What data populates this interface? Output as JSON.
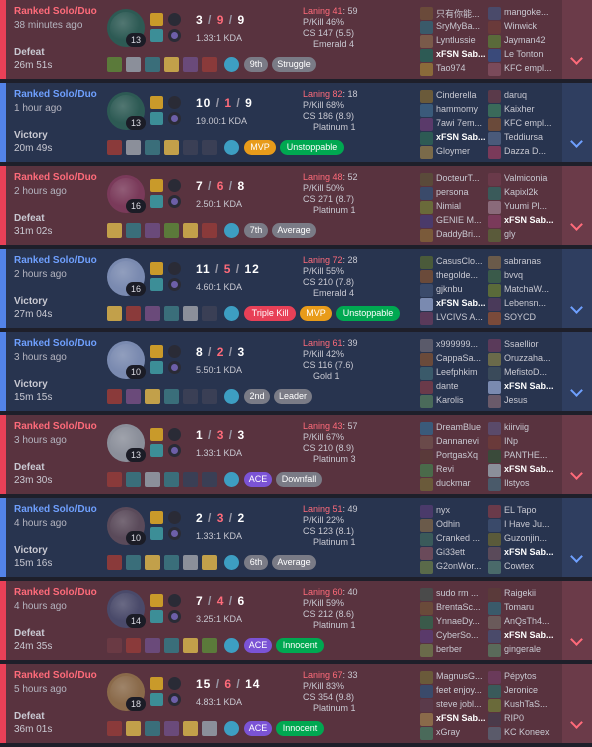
{
  "colors": {
    "defeat_bg": "#59333f",
    "victory_bg": "#28344f",
    "defeat_accent": "#e84057",
    "victory_accent": "#5383e8"
  },
  "games": [
    {
      "result_type": "defeat",
      "mode": "Ranked Solo/Duo",
      "time_ago": "38 minutes ago",
      "result": "Defeat",
      "duration": "26m 51s",
      "champion_color": "#2d5a54",
      "level": "13",
      "kills": "3",
      "deaths": "9",
      "assists": "9",
      "kda": "1.33:1 KDA",
      "laning": "Laning 41",
      "laning_score": ": 59",
      "pkill": "P/Kill 46%",
      "cs": "CS 147 (5.5)",
      "rank": "Emerald 4",
      "items": [
        "#5b7a3a",
        "#8b8f9a",
        "#3a6e7a",
        "#c2a04a",
        "#6a4a7a",
        "#8a3a3a"
      ],
      "badges": [
        {
          "text": "9th",
          "style": "b-place",
          "w": 24
        },
        {
          "text": "Struggle",
          "style": "b-place",
          "w": 44
        }
      ],
      "team_a": [
        {
          "name": "只有你能...",
          "color": "#6a4a3a"
        },
        {
          "name": "SryMyBa...",
          "color": "#3a5a6a"
        },
        {
          "name": "Lyntlussie",
          "color": "#7a5a4a"
        },
        {
          "name": "xFSN Sab...",
          "color": "#2d5a54",
          "me": true
        },
        {
          "name": "Tao974",
          "color": "#8a6a3a"
        }
      ],
      "team_b": [
        {
          "name": "mangoke...",
          "color": "#4a4a6a"
        },
        {
          "name": "Winwick",
          "color": "#6a3a3a"
        },
        {
          "name": "Jayman42",
          "color": "#5a6a3a"
        },
        {
          "name": "Le Tonton",
          "color": "#3a4a7a"
        },
        {
          "name": "KFC empl...",
          "color": "#7a4a5a"
        }
      ]
    },
    {
      "result_type": "victory",
      "mode": "Ranked Solo/Duo",
      "time_ago": "1 hour ago",
      "result": "Victory",
      "duration": "20m 49s",
      "champion_color": "#2d5a54",
      "level": "13",
      "kills": "10",
      "deaths": "1",
      "assists": "9",
      "kda": "19.00:1 KDA",
      "laning": "Laning 82",
      "laning_score": ": 18",
      "pkill": "P/Kill 68%",
      "cs": "CS 186 (8.9)",
      "rank": "Platinum 1",
      "items": [
        "#8a3a3a",
        "#8b8f9a",
        "#3a6e7a",
        "#c2a04a",
        "#3a3f55",
        "#3a3f55"
      ],
      "badges": [
        {
          "text": "MVP",
          "style": "b-gold",
          "w": 32
        },
        {
          "text": "Unstoppable",
          "style": "b-green",
          "w": 64
        }
      ],
      "team_a": [
        {
          "name": "Cinderella",
          "color": "#6a5a3a"
        },
        {
          "name": "hammomy",
          "color": "#3a5a7a"
        },
        {
          "name": "7awi 7em...",
          "color": "#5a3a6a"
        },
        {
          "name": "xFSN Sab...",
          "color": "#2d5a54",
          "me": true
        },
        {
          "name": "Gloymer",
          "color": "#7a6a4a"
        }
      ],
      "team_b": [
        {
          "name": "daruq",
          "color": "#5a3a4a"
        },
        {
          "name": "Kaixher",
          "color": "#3a6a5a"
        },
        {
          "name": "KFC empl...",
          "color": "#6a4a3a"
        },
        {
          "name": "Teddiursa",
          "color": "#4a5a7a"
        },
        {
          "name": "Dazza D...",
          "color": "#7a3a5a"
        }
      ]
    },
    {
      "result_type": "defeat",
      "mode": "Ranked Solo/Duo",
      "time_ago": "2 hours ago",
      "result": "Defeat",
      "duration": "31m 02s",
      "champion_color": "#7a3a5a",
      "level": "16",
      "kills": "7",
      "deaths": "6",
      "assists": "8",
      "kda": "2.50:1 KDA",
      "laning": "Laning 48",
      "laning_score": ": 52",
      "pkill": "P/Kill 50%",
      "cs": "CS 271 (8.7)",
      "rank": "Platinum 1",
      "items": [
        "#c2a04a",
        "#3a6e7a",
        "#6a4a7a",
        "#5b7a3a",
        "#c2a04a",
        "#8a3a3a"
      ],
      "badges": [
        {
          "text": "7th",
          "style": "b-place",
          "w": 24
        },
        {
          "text": "Average",
          "style": "b-place",
          "w": 44
        }
      ],
      "team_a": [
        {
          "name": "DocteurT...",
          "color": "#5a4a3a"
        },
        {
          "name": "persona",
          "color": "#3a4a6a"
        },
        {
          "name": "Nimial",
          "color": "#6a6a3a"
        },
        {
          "name": "GENIE M...",
          "color": "#4a3a6a"
        },
        {
          "name": "DaddyBri...",
          "color": "#7a5a3a"
        }
      ],
      "team_b": [
        {
          "name": "Valmiconia",
          "color": "#6a3a4a"
        },
        {
          "name": "Kapixl2k",
          "color": "#3a5a5a"
        },
        {
          "name": "Yuumi Pl...",
          "color": "#8a6a7a"
        },
        {
          "name": "xFSN Sab...",
          "color": "#7a3a5a",
          "me": true
        },
        {
          "name": "gly",
          "color": "#5a5a3a"
        }
      ]
    },
    {
      "result_type": "victory",
      "mode": "Ranked Solo/Duo",
      "time_ago": "2 hours ago",
      "result": "Victory",
      "duration": "27m 04s",
      "champion_color": "#7a8ab0",
      "level": "16",
      "kills": "11",
      "deaths": "5",
      "assists": "12",
      "kda": "4.60:1 KDA",
      "laning": "Laning 72",
      "laning_score": ": 28",
      "pkill": "P/Kill 55%",
      "cs": "CS 210 (7.8)",
      "rank": "Emerald 4",
      "items": [
        "#c2a04a",
        "#8a3a3a",
        "#6a4a7a",
        "#3a6e7a",
        "#8b8f9a",
        "#3a3f55"
      ],
      "badges": [
        {
          "text": "Triple Kill",
          "style": "b-red",
          "w": 52
        },
        {
          "text": "MVP",
          "style": "b-gold",
          "w": 32
        },
        {
          "text": "Unstoppable",
          "style": "b-green",
          "w": 64
        }
      ],
      "team_a": [
        {
          "name": "CasusClo...",
          "color": "#4a5a3a"
        },
        {
          "name": "thegolde...",
          "color": "#6a4a3a"
        },
        {
          "name": "gjknbu",
          "color": "#3a4a6a"
        },
        {
          "name": "xFSN Sab...",
          "color": "#7a8ab0",
          "me": true
        },
        {
          "name": "LVCIVS A...",
          "color": "#5a3a5a"
        }
      ],
      "team_b": [
        {
          "name": "sabranas",
          "color": "#6a5a4a"
        },
        {
          "name": "bvvq",
          "color": "#3a5a4a"
        },
        {
          "name": "MatchaW...",
          "color": "#5a6a3a"
        },
        {
          "name": "Lebensn...",
          "color": "#4a3a5a"
        },
        {
          "name": "SOYCD",
          "color": "#7a4a3a"
        }
      ]
    },
    {
      "result_type": "victory",
      "mode": "Ranked Solo/Duo",
      "time_ago": "3 hours ago",
      "result": "Victory",
      "duration": "15m 15s",
      "champion_color": "#7a8ab0",
      "level": "10",
      "kills": "8",
      "deaths": "2",
      "assists": "3",
      "kda": "5.50:1 KDA",
      "laning": "Laning 61",
      "laning_score": ": 39",
      "pkill": "P/Kill 42%",
      "cs": "CS 116 (7.6)",
      "rank": "Gold 1",
      "items": [
        "#8a3a3a",
        "#6a4a7a",
        "#c2a04a",
        "#3a6e7a",
        "#3a3f55",
        "#3a3f55"
      ],
      "badges": [
        {
          "text": "2nd",
          "style": "b-place",
          "w": 26
        },
        {
          "text": "Leader",
          "style": "b-place",
          "w": 38
        }
      ],
      "team_a": [
        {
          "name": "x999999...",
          "color": "#5a5a6a"
        },
        {
          "name": "CappaSa...",
          "color": "#6a4a3a"
        },
        {
          "name": "Leefphkim",
          "color": "#3a5a6a"
        },
        {
          "name": "dante",
          "color": "#6a3a4a"
        },
        {
          "name": "Karolis",
          "color": "#4a6a5a"
        }
      ],
      "team_b": [
        {
          "name": "Ssaellior",
          "color": "#5a3a5a"
        },
        {
          "name": "Oruzzaha...",
          "color": "#6a6a4a"
        },
        {
          "name": "MefistoD...",
          "color": "#3a4a5a"
        },
        {
          "name": "xFSN Sab...",
          "color": "#7a8ab0",
          "me": true
        },
        {
          "name": "Jesus",
          "color": "#6a5a6a"
        }
      ]
    },
    {
      "result_type": "defeat",
      "mode": "Ranked Solo/Duo",
      "time_ago": "3 hours ago",
      "result": "Defeat",
      "duration": "23m 30s",
      "champion_color": "#8b8f9a",
      "level": "13",
      "kills": "1",
      "deaths": "3",
      "assists": "3",
      "kda": "1.33:1 KDA",
      "laning": "Laning 43",
      "laning_score": ": 57",
      "pkill": "P/Kill 67%",
      "cs": "CS 210 (8.9)",
      "rank": "Platinum 3",
      "items": [
        "#8a3a3a",
        "#3a6e7a",
        "#8b8f9a",
        "#3a6e7a",
        "#3a3f55",
        "#3a3f55"
      ],
      "badges": [
        {
          "text": "ACE",
          "style": "b-purple",
          "w": 28
        },
        {
          "text": "Downfall",
          "style": "b-place",
          "w": 46
        }
      ],
      "team_a": [
        {
          "name": "DreamBlue",
          "color": "#3a5a7a"
        },
        {
          "name": "Dannanevi",
          "color": "#6a4a4a"
        },
        {
          "name": "PortgasXq",
          "color": "#5a3a3a"
        },
        {
          "name": "Revi",
          "color": "#4a6a4a"
        },
        {
          "name": "duckmar",
          "color": "#6a5a3a"
        }
      ],
      "team_b": [
        {
          "name": "kiirviig",
          "color": "#5a4a6a"
        },
        {
          "name": "INp",
          "color": "#6a3a3a"
        },
        {
          "name": "PANTHE...",
          "color": "#3a4a3a"
        },
        {
          "name": "xFSN Sab...",
          "color": "#8b8f9a",
          "me": true
        },
        {
          "name": "Ilstyos",
          "color": "#4a5a6a"
        }
      ]
    },
    {
      "result_type": "victory",
      "mode": "Ranked Solo/Duo",
      "time_ago": "4 hours ago",
      "result": "Victory",
      "duration": "15m 16s",
      "champion_color": "#5a4a5a",
      "level": "10",
      "kills": "2",
      "deaths": "3",
      "assists": "2",
      "kda": "1.33:1 KDA",
      "laning": "Laning 51",
      "laning_score": ": 49",
      "pkill": "P/Kill 22%",
      "cs": "CS 123 (8.1)",
      "rank": "Platinum 1",
      "items": [
        "#8a3a3a",
        "#3a6e7a",
        "#c2a04a",
        "#3a6e7a",
        "#8b8f9a",
        "#c2a04a"
      ],
      "badges": [
        {
          "text": "6th",
          "style": "b-place",
          "w": 24
        },
        {
          "text": "Average",
          "style": "b-place",
          "w": 44
        }
      ],
      "team_a": [
        {
          "name": "nyx",
          "color": "#4a3a6a"
        },
        {
          "name": "Odhin",
          "color": "#6a5a4a"
        },
        {
          "name": "Cranked ...",
          "color": "#3a5a5a"
        },
        {
          "name": "Gi33ett",
          "color": "#6a4a5a"
        },
        {
          "name": "G2onWor...",
          "color": "#5a6a4a"
        }
      ],
      "team_b": [
        {
          "name": "EL Tapo",
          "color": "#6a3a4a"
        },
        {
          "name": "I Have Ju...",
          "color": "#3a4a6a"
        },
        {
          "name": "Guzonjin...",
          "color": "#5a5a3a"
        },
        {
          "name": "xFSN Sab...",
          "color": "#5a4a5a",
          "me": true
        },
        {
          "name": "Cowtex",
          "color": "#4a6a6a"
        }
      ]
    },
    {
      "result_type": "defeat",
      "mode": "Ranked Solo/Duo",
      "time_ago": "4 hours ago",
      "result": "Defeat",
      "duration": "24m 35s",
      "champion_color": "#4a4a6a",
      "level": "14",
      "kills": "7",
      "deaths": "4",
      "assists": "6",
      "kda": "3.25:1 KDA",
      "laning": "Laning 60",
      "laning_score": ": 40",
      "pkill": "P/Kill 59%",
      "cs": "CS 212 (8.6)",
      "rank": "Platinum 1",
      "items": [
        "#6a3a44",
        "#8a3a3a",
        "#6a4a7a",
        "#3a6e7a",
        "#c2a04a",
        "#5b7a3a"
      ],
      "badges": [
        {
          "text": "ACE",
          "style": "b-purple",
          "w": 28
        },
        {
          "text": "Innocent",
          "style": "b-green",
          "w": 48
        }
      ],
      "team_a": [
        {
          "name": "sudo rm ...",
          "color": "#4a4a4a"
        },
        {
          "name": "BrentaSc...",
          "color": "#6a4a3a"
        },
        {
          "name": "YnnaeDy...",
          "color": "#3a5a4a"
        },
        {
          "name": "CyberSo...",
          "color": "#5a3a6a"
        },
        {
          "name": "berber",
          "color": "#6a6a4a"
        }
      ],
      "team_b": [
        {
          "name": "Raigekii",
          "color": "#5a3a3a"
        },
        {
          "name": "Tomaru",
          "color": "#3a5a6a"
        },
        {
          "name": "AnQsTh4...",
          "color": "#6a5a5a"
        },
        {
          "name": "xFSN Sab...",
          "color": "#4a4a6a",
          "me": true
        },
        {
          "name": "gingerale",
          "color": "#5a6a5a"
        }
      ]
    },
    {
      "result_type": "defeat",
      "mode": "Ranked Solo/Duo",
      "time_ago": "5 hours ago",
      "result": "Defeat",
      "duration": "36m 01s",
      "champion_color": "#8a6a4a",
      "level": "18",
      "kills": "15",
      "deaths": "6",
      "assists": "14",
      "kda": "4.83:1 KDA",
      "laning": "Laning 67",
      "laning_score": ": 33",
      "pkill": "P/Kill 83%",
      "cs": "CS 354 (9.8)",
      "rank": "Platinum 1",
      "items": [
        "#8a3a3a",
        "#c2a04a",
        "#3a6e7a",
        "#6a4a7a",
        "#c2a04a",
        "#8b8f9a"
      ],
      "badges": [
        {
          "text": "ACE",
          "style": "b-purple",
          "w": 28
        },
        {
          "text": "Innocent",
          "style": "b-green",
          "w": 48
        }
      ],
      "team_a": [
        {
          "name": "MagnusG...",
          "color": "#6a5a3a"
        },
        {
          "name": "feet enjoy...",
          "color": "#3a4a6a"
        },
        {
          "name": "steve jobl...",
          "color": "#5a3a4a"
        },
        {
          "name": "xFSN Sab...",
          "color": "#8a6a4a",
          "me": true
        },
        {
          "name": "xGray",
          "color": "#4a6a5a"
        }
      ],
      "team_b": [
        {
          "name": "Pépytos",
          "color": "#6a3a5a"
        },
        {
          "name": "Jeronice",
          "color": "#3a5a5a"
        },
        {
          "name": "KushTaS...",
          "color": "#6a6a3a"
        },
        {
          "name": "RIP0",
          "color": "#4a3a4a"
        },
        {
          "name": "KC Koneex",
          "color": "#5a5a6a"
        }
      ]
    }
  ]
}
